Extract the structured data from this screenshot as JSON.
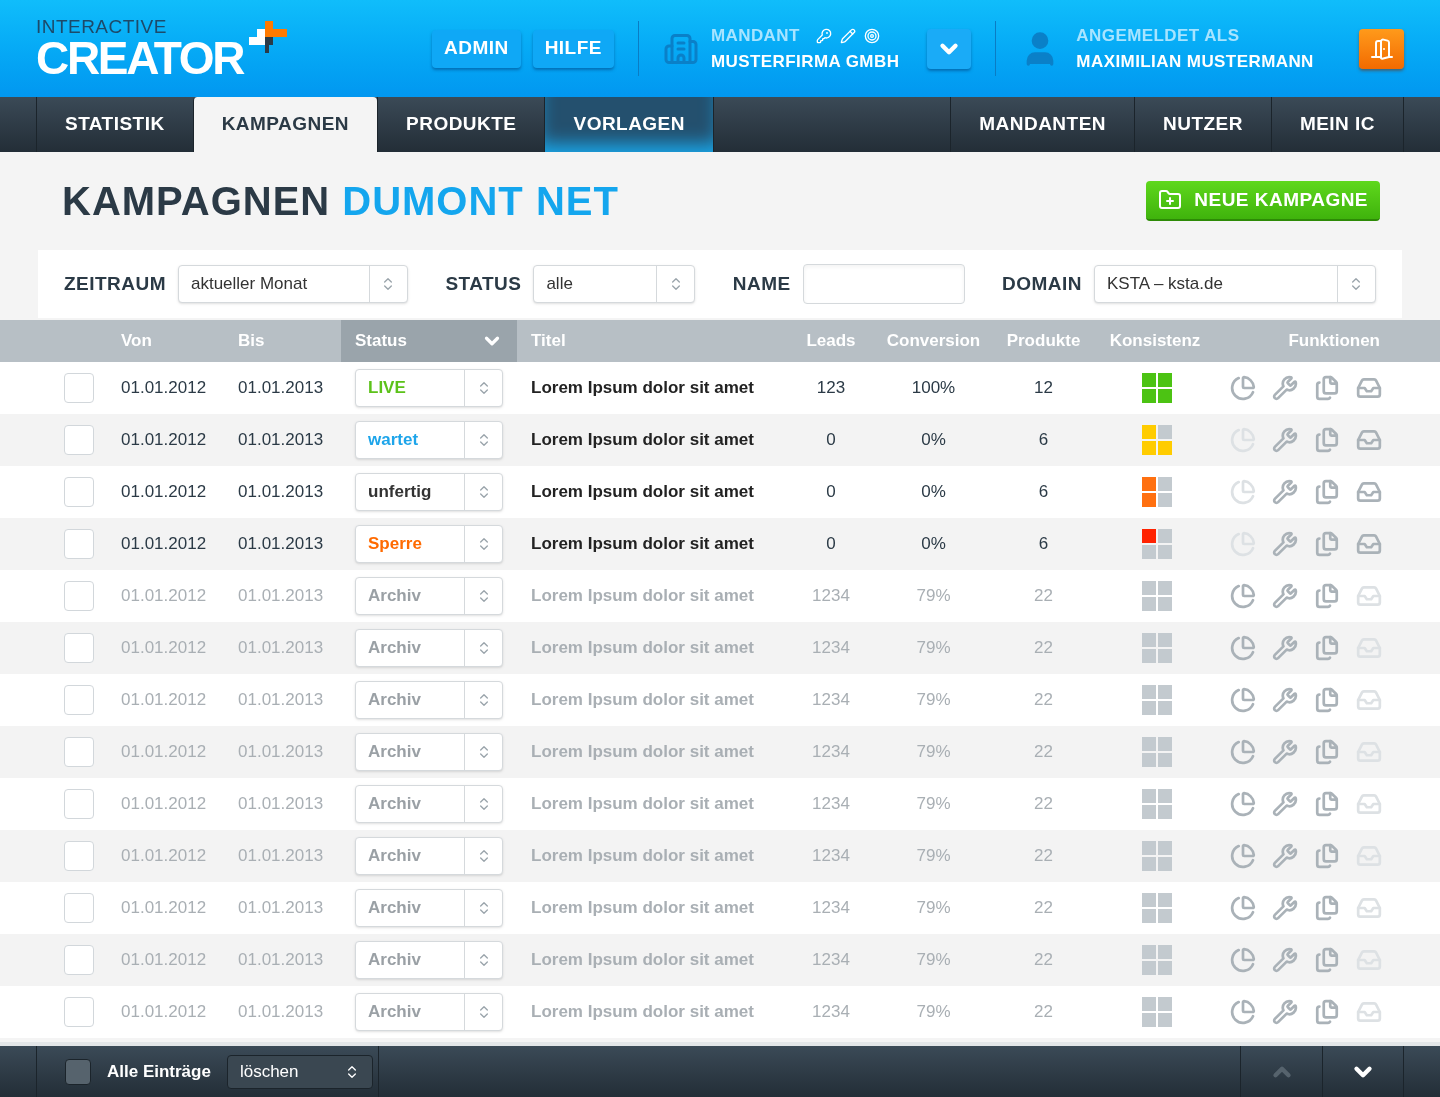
{
  "header": {
    "logo_top": "INTERACTIVE",
    "logo_main": "CREATOR",
    "buttons": [
      "ADMIN",
      "HILFE"
    ],
    "client_label": "MANDANT",
    "client_name": "MUSTERFIRMA GMBH",
    "user_label": "ANGEMELDET ALS",
    "user_name": "MAXIMILIAN MUSTERMANN"
  },
  "nav_left": [
    {
      "label": "STATISTIK",
      "selected": false,
      "highlighted": false
    },
    {
      "label": "KAMPAGNEN",
      "selected": true,
      "highlighted": false
    },
    {
      "label": "PRODUKTE",
      "selected": false,
      "highlighted": false
    },
    {
      "label": "VORLAGEN",
      "selected": false,
      "highlighted": true
    }
  ],
  "nav_right": [
    {
      "label": "MANDANTEN",
      "selected": false
    },
    {
      "label": "NUTZER",
      "selected": false
    },
    {
      "label": "MEIN IC",
      "selected": false
    }
  ],
  "page": {
    "title": "KAMPAGNEN",
    "title_accent": "DUMONT NET",
    "new_button": "NEUE KAMPAGNE"
  },
  "filters": [
    {
      "kind": "select",
      "label": "ZEITRAUM",
      "value": "aktueller Monat"
    },
    {
      "kind": "select",
      "label": "STATUS",
      "value": "alle"
    },
    {
      "kind": "input",
      "label": "NAME"
    },
    {
      "kind": "select",
      "label": "DOMAIN",
      "value": "KSTA – ksta.de"
    }
  ],
  "table": {
    "columns": [
      {
        "label": "Von",
        "selected": false
      },
      {
        "label": "Bis",
        "selected": false
      },
      {
        "label": "Status",
        "selected": true
      },
      {
        "label": "Titel",
        "selected": false
      },
      {
        "label": "Leads",
        "selected": false
      },
      {
        "label": "Conversion",
        "selected": false
      },
      {
        "label": "Produkte",
        "selected": false
      },
      {
        "label": "Konsistenz",
        "selected": false
      },
      {
        "label": "Funktionen",
        "selected": false
      }
    ],
    "rows": [
      {
        "checked": false,
        "dimmed": false,
        "von": "01.01.2012",
        "bis": "01.01.2013",
        "status": "LIVE",
        "kind": "live",
        "title": "Lorem Ipsum dolor sit amet",
        "leads": "123",
        "conversion": "100%",
        "produkte": "12",
        "pieces": [
          {
            "filled": true
          },
          {
            "filled": true
          },
          {
            "filled": true
          },
          {
            "filled": true
          }
        ],
        "color": "#4cc313",
        "stats_enabled": true,
        "export_enabled": true
      },
      {
        "checked": false,
        "dimmed": false,
        "von": "01.01.2012",
        "bis": "01.01.2013",
        "status": "wartet",
        "kind": "wartet",
        "title": "Lorem Ipsum dolor sit amet",
        "leads": "0",
        "conversion": "0%",
        "produkte": "6",
        "pieces": [
          {
            "filled": true
          },
          {
            "filled": true
          },
          {
            "filled": true
          },
          {
            "filled": false
          }
        ],
        "color": "#ffcc00",
        "stats_enabled": false,
        "export_enabled": true
      },
      {
        "checked": false,
        "dimmed": false,
        "von": "01.01.2012",
        "bis": "01.01.2013",
        "status": "unfertig",
        "kind": "unfertig",
        "title": "Lorem Ipsum dolor sit amet",
        "leads": "0",
        "conversion": "0%",
        "produkte": "6",
        "pieces": [
          {
            "filled": true
          },
          {
            "filled": true
          },
          {
            "filled": false
          },
          {
            "filled": false
          }
        ],
        "color": "#ff7010",
        "stats_enabled": false,
        "export_enabled": true
      },
      {
        "checked": false,
        "dimmed": false,
        "von": "01.01.2012",
        "bis": "01.01.2013",
        "status": "Sperre",
        "kind": "sperre",
        "title": "Lorem Ipsum dolor sit amet",
        "leads": "0",
        "conversion": "0%",
        "produkte": "6",
        "pieces": [
          {
            "filled": true
          },
          {
            "filled": false
          },
          {
            "filled": false
          },
          {
            "filled": false
          }
        ],
        "color": "#ff2200",
        "stats_enabled": false,
        "export_enabled": true
      },
      {
        "checked": false,
        "dimmed": true,
        "von": "01.01.2012",
        "bis": "01.01.2013",
        "status": "Archiv",
        "kind": "archiv",
        "title": "Lorem Ipsum dolor sit amet",
        "leads": "1234",
        "conversion": "79%",
        "produkte": "22",
        "pieces": [
          {
            "filled": false
          },
          {
            "filled": false
          },
          {
            "filled": false
          },
          {
            "filled": false
          }
        ],
        "stats_enabled": true,
        "export_enabled": false
      },
      {
        "checked": false,
        "dimmed": true,
        "von": "01.01.2012",
        "bis": "01.01.2013",
        "status": "Archiv",
        "kind": "archiv",
        "title": "Lorem Ipsum dolor sit amet",
        "leads": "1234",
        "conversion": "79%",
        "produkte": "22",
        "pieces": [
          {
            "filled": false
          },
          {
            "filled": false
          },
          {
            "filled": false
          },
          {
            "filled": false
          }
        ],
        "stats_enabled": true,
        "export_enabled": false
      },
      {
        "checked": false,
        "dimmed": true,
        "von": "01.01.2012",
        "bis": "01.01.2013",
        "status": "Archiv",
        "kind": "archiv",
        "title": "Lorem Ipsum dolor sit amet",
        "leads": "1234",
        "conversion": "79%",
        "produkte": "22",
        "pieces": [
          {
            "filled": false
          },
          {
            "filled": false
          },
          {
            "filled": false
          },
          {
            "filled": false
          }
        ],
        "stats_enabled": true,
        "export_enabled": false
      },
      {
        "checked": false,
        "dimmed": true,
        "von": "01.01.2012",
        "bis": "01.01.2013",
        "status": "Archiv",
        "kind": "archiv",
        "title": "Lorem Ipsum dolor sit amet",
        "leads": "1234",
        "conversion": "79%",
        "produkte": "22",
        "pieces": [
          {
            "filled": false
          },
          {
            "filled": false
          },
          {
            "filled": false
          },
          {
            "filled": false
          }
        ],
        "stats_enabled": true,
        "export_enabled": false
      },
      {
        "checked": false,
        "dimmed": true,
        "von": "01.01.2012",
        "bis": "01.01.2013",
        "status": "Archiv",
        "kind": "archiv",
        "title": "Lorem Ipsum dolor sit amet",
        "leads": "1234",
        "conversion": "79%",
        "produkte": "22",
        "pieces": [
          {
            "filled": false
          },
          {
            "filled": false
          },
          {
            "filled": false
          },
          {
            "filled": false
          }
        ],
        "stats_enabled": true,
        "export_enabled": false
      },
      {
        "checked": false,
        "dimmed": true,
        "von": "01.01.2012",
        "bis": "01.01.2013",
        "status": "Archiv",
        "kind": "archiv",
        "title": "Lorem Ipsum dolor sit amet",
        "leads": "1234",
        "conversion": "79%",
        "produkte": "22",
        "pieces": [
          {
            "filled": false
          },
          {
            "filled": false
          },
          {
            "filled": false
          },
          {
            "filled": false
          }
        ],
        "stats_enabled": true,
        "export_enabled": false
      },
      {
        "checked": false,
        "dimmed": true,
        "von": "01.01.2012",
        "bis": "01.01.2013",
        "status": "Archiv",
        "kind": "archiv",
        "title": "Lorem Ipsum dolor sit amet",
        "leads": "1234",
        "conversion": "79%",
        "produkte": "22",
        "pieces": [
          {
            "filled": false
          },
          {
            "filled": false
          },
          {
            "filled": false
          },
          {
            "filled": false
          }
        ],
        "stats_enabled": true,
        "export_enabled": false
      },
      {
        "checked": false,
        "dimmed": true,
        "von": "01.01.2012",
        "bis": "01.01.2013",
        "status": "Archiv",
        "kind": "archiv",
        "title": "Lorem Ipsum dolor sit amet",
        "leads": "1234",
        "conversion": "79%",
        "produkte": "22",
        "pieces": [
          {
            "filled": false
          },
          {
            "filled": false
          },
          {
            "filled": false
          },
          {
            "filled": false
          }
        ],
        "stats_enabled": true,
        "export_enabled": false
      },
      {
        "checked": false,
        "dimmed": true,
        "von": "01.01.2012",
        "bis": "01.01.2013",
        "status": "Archiv",
        "kind": "archiv",
        "title": "Lorem Ipsum dolor sit amet",
        "leads": "1234",
        "conversion": "79%",
        "produkte": "22",
        "pieces": [
          {
            "filled": false
          },
          {
            "filled": false
          },
          {
            "filled": false
          },
          {
            "filled": false
          }
        ],
        "stats_enabled": true,
        "export_enabled": false
      }
    ]
  },
  "footer": {
    "select_all_checked": false,
    "select_all_label": "Alle Einträge",
    "action": "löschen",
    "up_disabled": true,
    "down_disabled": false
  }
}
